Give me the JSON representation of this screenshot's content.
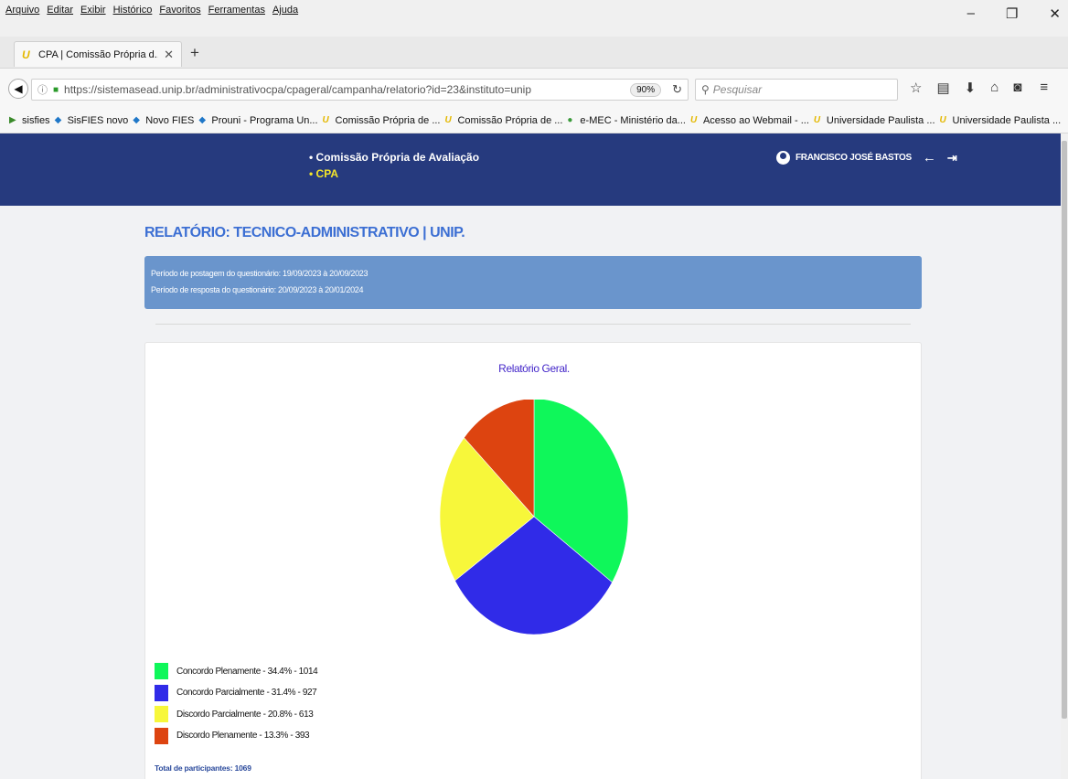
{
  "browser": {
    "menu": [
      "Arquivo",
      "Editar",
      "Exibir",
      "Histórico",
      "Favoritos",
      "Ferramentas",
      "Ajuda"
    ],
    "tab_title": "CPA | Comissão Própria d...",
    "url": "https://sistemasead.unip.br/administrativocpa/cpageral/campanha/relatorio?id=23&instituto=unip",
    "zoom": "90%",
    "search_placeholder": "Pesquisar",
    "bookmarks": [
      "sisfies",
      "SisFIES novo",
      "Novo FIES",
      "Prouni - Programa Un...",
      "Comissão Própria de ...",
      "Comissão Própria de ...",
      "e-MEC - Ministério da...",
      "Acesso ao Webmail - ...",
      "Universidade Paulista ...",
      "Universidade Paulista ..."
    ],
    "bookmarks_overflow": "»"
  },
  "header": {
    "nav_item_1": "• Comissão Própria de Avaliação",
    "nav_item_2": "• CPA",
    "user_name": "FRANCISCO JOSÉ BASTOS"
  },
  "report": {
    "title": "RELATÓRIO: TECNICO-ADMINISTRATIVO | UNIP.",
    "posting_period": "Período de postagem do questionário: 19/09/2023 à 20/09/2023",
    "response_period": "Período de resposta do questionário: 20/09/2023 à 20/01/2024",
    "total": "Total de participantes: 1069"
  },
  "chart_data": {
    "type": "pie",
    "title": "Relatório Geral.",
    "slices": [
      {
        "label": "Concordo Plenamente - 34.4% - 1014",
        "name": "Concordo Plenamente",
        "percent": 34.4,
        "value": 1014,
        "color": "#0ff75a"
      },
      {
        "label": "Concordo Parcialmente - 31.4% - 927",
        "name": "Concordo Parcialmente",
        "percent": 31.4,
        "value": 927,
        "color": "#302be8"
      },
      {
        "label": "Discordo Parcialmente - 20.8% - 613",
        "name": "Discordo Parcialmente",
        "percent": 20.8,
        "value": 613,
        "color": "#f7f73a"
      },
      {
        "label": "Discordo Plenamente - 13.3% - 393",
        "name": "Discordo Plenamente",
        "percent": 13.3,
        "value": 393,
        "color": "#dd4410"
      }
    ],
    "start_angle": "12 o'clock",
    "direction": "clockwise",
    "legend_position": "bottom-left"
  }
}
